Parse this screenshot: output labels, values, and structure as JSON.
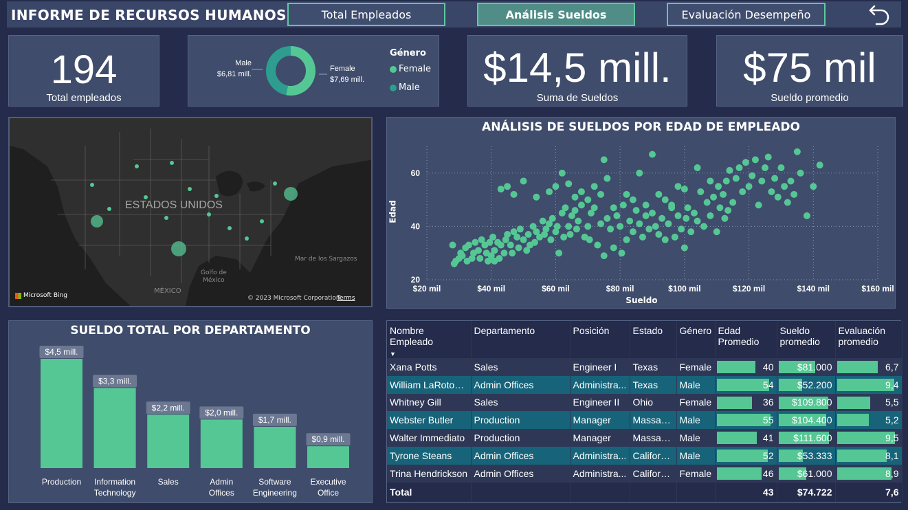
{
  "header": {
    "title": "INFORME DE RECURSOS HUMANOS",
    "nav": [
      {
        "label": "Total Empleados"
      },
      {
        "label": "Análisis Sueldos"
      },
      {
        "label": "Evaluación Desempeño"
      }
    ]
  },
  "colors": {
    "background": "#242b4b",
    "panel": "#3f4c6b",
    "accent": "#55c795",
    "accent_dark": "#2e9c8e",
    "row_highlight": "#17647a"
  },
  "kpis": {
    "total_employees": {
      "value": "194",
      "label": "Total empleados"
    },
    "salary_sum": {
      "value": "$14,5 mill.",
      "label": "Suma de Sueldos"
    },
    "salary_avg": {
      "value": "$75 mil",
      "label": "Sueldo promedio"
    }
  },
  "gender_donut": {
    "legend_title": "Género",
    "slices": [
      {
        "name": "Female",
        "value": 7.69,
        "label": "$7,69 mill.",
        "color": "#55c795"
      },
      {
        "name": "Male",
        "value": 6.81,
        "label": "$6,81 mill.",
        "color": "#2e9c8e"
      }
    ]
  },
  "map": {
    "country_label": "ESTADOS UNIDOS",
    "labels": [
      "Golfo de México",
      "MÉXICO",
      "Mar de los Sargazos"
    ],
    "golfo": [
      "Golfo de",
      "México"
    ],
    "attribution": "© 2023 Microsoft Corporation",
    "terms": "Terms",
    "brand": "Microsoft Bing"
  },
  "chart_data": [
    {
      "type": "scatter",
      "title": "ANÁLISIS DE SUELDOS POR EDAD DE EMPLEADO",
      "xlabel": "Sueldo",
      "ylabel": "Edad",
      "xlim": [
        20000,
        160000
      ],
      "ylim": [
        20,
        70
      ],
      "x_ticks": [
        "$20 mil",
        "$40 mil",
        "$60 mil",
        "$80 mil",
        "$100 mil",
        "$120 mil",
        "$140 mil",
        "$160 mil"
      ],
      "y_ticks": [
        "20",
        "40",
        "60"
      ],
      "grid": true,
      "points": [
        [
          28000,
          33
        ],
        [
          28500,
          26
        ],
        [
          29000,
          27
        ],
        [
          30000,
          28
        ],
        [
          30500,
          30
        ],
        [
          31000,
          29
        ],
        [
          32000,
          32
        ],
        [
          32500,
          27
        ],
        [
          33000,
          33
        ],
        [
          34000,
          28
        ],
        [
          34500,
          30
        ],
        [
          35000,
          34
        ],
        [
          36000,
          31
        ],
        [
          36500,
          28
        ],
        [
          37000,
          35
        ],
        [
          38000,
          33
        ],
        [
          38500,
          30
        ],
        [
          39000,
          27
        ],
        [
          39500,
          34
        ],
        [
          40000,
          29
        ],
        [
          40500,
          36
        ],
        [
          41000,
          31
        ],
        [
          41000,
          27
        ],
        [
          42000,
          34
        ],
        [
          42500,
          28
        ],
        [
          43000,
          33
        ],
        [
          44000,
          30
        ],
        [
          44500,
          35
        ],
        [
          45000,
          37
        ],
        [
          46000,
          33
        ],
        [
          46500,
          30
        ],
        [
          47000,
          38
        ],
        [
          48000,
          36
        ],
        [
          48500,
          32
        ],
        [
          49000,
          39
        ],
        [
          50000,
          35
        ],
        [
          51000,
          31
        ],
        [
          51500,
          37
        ],
        [
          52000,
          33
        ],
        [
          53000,
          40
        ],
        [
          53500,
          34
        ],
        [
          54000,
          38
        ],
        [
          55000,
          36
        ],
        [
          56000,
          42
        ],
        [
          56500,
          37
        ],
        [
          57000,
          39
        ],
        [
          58000,
          41
        ],
        [
          58500,
          35
        ],
        [
          59000,
          43
        ],
        [
          60000,
          38
        ],
        [
          60500,
          40
        ],
        [
          61000,
          30
        ],
        [
          62000,
          45
        ],
        [
          62500,
          36
        ],
        [
          63000,
          47
        ],
        [
          64000,
          40
        ],
        [
          64500,
          37
        ],
        [
          65000,
          44
        ],
        [
          66000,
          46
        ],
        [
          66500,
          39
        ],
        [
          67000,
          42
        ],
        [
          68000,
          48
        ],
        [
          69000,
          36
        ],
        [
          70000,
          40
        ],
        [
          70500,
          35
        ],
        [
          71000,
          45
        ],
        [
          72000,
          47
        ],
        [
          73000,
          33
        ],
        [
          74000,
          41
        ],
        [
          75000,
          29
        ],
        [
          76000,
          43
        ],
        [
          77000,
          39
        ],
        [
          78000,
          32
        ],
        [
          79000,
          44
        ],
        [
          80000,
          40
        ],
        [
          80500,
          30
        ],
        [
          81000,
          48
        ],
        [
          82000,
          35
        ],
        [
          83000,
          42
        ],
        [
          84000,
          38
        ],
        [
          85000,
          46
        ],
        [
          86000,
          41
        ],
        [
          87000,
          36
        ],
        [
          88000,
          44
        ],
        [
          89000,
          39
        ],
        [
          90000,
          45
        ],
        [
          91000,
          40
        ],
        [
          92000,
          37
        ],
        [
          93000,
          43
        ],
        [
          94000,
          35
        ],
        [
          95000,
          41
        ],
        [
          96000,
          48
        ],
        [
          97000,
          36
        ],
        [
          98000,
          44
        ],
        [
          99000,
          39
        ],
        [
          100000,
          32
        ],
        [
          100500,
          43
        ],
        [
          101000,
          47
        ],
        [
          102000,
          38
        ],
        [
          103000,
          45
        ],
        [
          104000,
          42
        ],
        [
          105000,
          53
        ],
        [
          106000,
          40
        ],
        [
          107000,
          49
        ],
        [
          108000,
          44
        ],
        [
          109000,
          51
        ],
        [
          110000,
          38
        ],
        [
          110500,
          55
        ],
        [
          111000,
          47
        ],
        [
          112000,
          52
        ],
        [
          112500,
          43
        ],
        [
          113000,
          57
        ],
        [
          113500,
          46
        ],
        [
          114000,
          61
        ],
        [
          115000,
          49
        ],
        [
          116000,
          58
        ],
        [
          117000,
          62
        ],
        [
          118000,
          53
        ],
        [
          119000,
          64
        ],
        [
          120000,
          55
        ],
        [
          121000,
          59
        ],
        [
          122000,
          65
        ],
        [
          123000,
          48
        ],
        [
          124000,
          57
        ],
        [
          125000,
          62
        ],
        [
          126000,
          66
        ],
        [
          127000,
          53
        ],
        [
          128000,
          58
        ],
        [
          129000,
          51
        ],
        [
          130000,
          62
        ],
        [
          131000,
          55
        ],
        [
          132000,
          49
        ],
        [
          133000,
          57
        ],
        [
          134000,
          52
        ],
        [
          135000,
          68
        ],
        [
          136000,
          60
        ],
        [
          138000,
          44
        ],
        [
          140000,
          55
        ],
        [
          142000,
          63
        ],
        [
          70000,
          50
        ],
        [
          72000,
          55
        ],
        [
          74000,
          52
        ],
        [
          76000,
          58
        ],
        [
          78000,
          47
        ],
        [
          82000,
          52
        ],
        [
          86000,
          60
        ],
        [
          90000,
          67
        ],
        [
          94000,
          50
        ],
        [
          98000,
          55
        ],
        [
          104000,
          62
        ],
        [
          108000,
          57
        ],
        [
          45000,
          55
        ],
        [
          47000,
          52
        ],
        [
          43000,
          54
        ],
        [
          58000,
          53
        ],
        [
          60000,
          55
        ],
        [
          62000,
          60
        ],
        [
          50000,
          57
        ],
        [
          54000,
          51
        ],
        [
          66000,
          51
        ],
        [
          68000,
          53
        ],
        [
          84000,
          50
        ],
        [
          88000,
          48
        ],
        [
          92000,
          52
        ],
        [
          96000,
          47
        ],
        [
          100000,
          54
        ],
        [
          75000,
          65
        ],
        [
          64000,
          56
        ]
      ]
    },
    {
      "type": "bar",
      "title": "SUELDO TOTAL POR DEPARTAMENTO",
      "categories": [
        "Production",
        "Information Technology",
        "Sales",
        "Admin Offices",
        "Software Engineering",
        "Executive Office"
      ],
      "category_lines": [
        [
          "Production"
        ],
        [
          "Information",
          "Technology"
        ],
        [
          "Sales"
        ],
        [
          "Admin",
          "Offices"
        ],
        [
          "Software",
          "Engineering"
        ],
        [
          "Executive",
          "Office"
        ]
      ],
      "values": [
        4.5,
        3.3,
        2.2,
        2.0,
        1.7,
        0.9
      ],
      "data_labels": [
        "$4,5 mill.",
        "$3,3 mill.",
        "$2,2 mill.",
        "$2,0 mill.",
        "$1,7 mill.",
        "$0,9 mill."
      ],
      "ylim": [
        0,
        4.5
      ]
    }
  ],
  "table": {
    "headers": [
      "Nombre Empleado",
      "Departamento",
      "Posición",
      "Estado",
      "Género",
      "Edad Promedio",
      "Sueldo promedio",
      "Evaluación promedio"
    ],
    "sort_indicator": "▼",
    "rows": [
      {
        "name": "Xana Potts",
        "dept": "Sales",
        "position": "Engineer I",
        "state": "Texas",
        "gender": "Female",
        "age": "40",
        "age_n": 40,
        "salary": "$81.000",
        "salary_n": 81000,
        "eval": "6,7",
        "eval_n": 6.7
      },
      {
        "name": "William LaRoton...",
        "dept": "Admin Offices",
        "position": "Administra...",
        "state": "Texas",
        "gender": "Male",
        "age": "54",
        "age_n": 54,
        "salary": "$52.200",
        "salary_n": 52200,
        "eval": "9,4",
        "eval_n": 9.4
      },
      {
        "name": "Whitney Gill",
        "dept": "Sales",
        "position": "Engineer II",
        "state": "Ohio",
        "gender": "Female",
        "age": "36",
        "age_n": 36,
        "salary": "$109.800",
        "salary_n": 109800,
        "eval": "5,5",
        "eval_n": 5.5
      },
      {
        "name": "Webster Butler",
        "dept": "Production",
        "position": "Manager",
        "state": "Massac...",
        "gender": "Male",
        "age": "55",
        "age_n": 55,
        "salary": "$104.400",
        "salary_n": 104400,
        "eval": "5,2",
        "eval_n": 5.2
      },
      {
        "name": "Walter Immediato",
        "dept": "Production",
        "position": "Manager",
        "state": "Massac...",
        "gender": "Male",
        "age": "41",
        "age_n": 41,
        "salary": "$111.600",
        "salary_n": 111600,
        "eval": "9,5",
        "eval_n": 9.5
      },
      {
        "name": "Tyrone Steans",
        "dept": "Admin Offices",
        "position": "Administra...",
        "state": "California",
        "gender": "Male",
        "age": "52",
        "age_n": 52,
        "salary": "$53.333",
        "salary_n": 53333,
        "eval": "8,1",
        "eval_n": 8.1
      },
      {
        "name": "Trina Hendrickson",
        "dept": "Admin Offices",
        "position": "Administra...",
        "state": "California",
        "gender": "Female",
        "age": "46",
        "age_n": 46,
        "salary": "$61.000",
        "salary_n": 61000,
        "eval": "8,9",
        "eval_n": 8.9
      }
    ],
    "total": {
      "label": "Total",
      "age": "43",
      "salary": "$74.722",
      "eval": "7,6"
    }
  }
}
